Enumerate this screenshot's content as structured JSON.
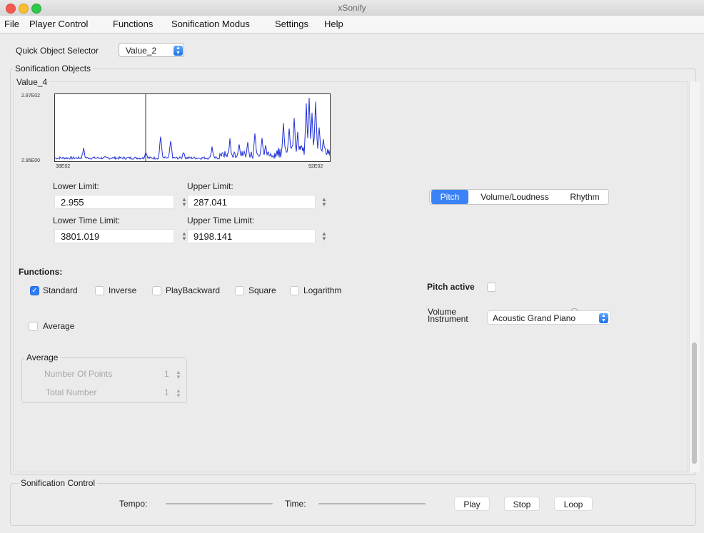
{
  "window": {
    "title": "xSonify"
  },
  "menu": [
    "File",
    "Player Control",
    "Functions",
    "Sonification Modus",
    "Settings",
    "Help"
  ],
  "quick_selector": {
    "label": "Quick Object Selector",
    "value": "Value_2"
  },
  "sonification_objects": {
    "legend": "Sonification Objects",
    "object_title": "Value_4",
    "plot": {
      "y_top_label": "2.87E02",
      "y_bottom_label": "2.95E00",
      "x_left_label": "38E02",
      "x_right_label": "92E02",
      "line_color": "#1f2fd6"
    },
    "limits": {
      "lower_label": "Lower Limit:",
      "lower_value": "2.955",
      "upper_label": "Upper Limit:",
      "upper_value": "287.041",
      "lower_time_label": "Lower Time Limit:",
      "lower_time_value": "3801.019",
      "upper_time_label": "Upper Time Limit:",
      "upper_time_value": "9198.141"
    },
    "functions": {
      "title": "Functions:",
      "options": [
        {
          "label": "Standard",
          "checked": true
        },
        {
          "label": "Inverse",
          "checked": false
        },
        {
          "label": "PlayBackward",
          "checked": false
        },
        {
          "label": "Square",
          "checked": false
        },
        {
          "label": "Logarithm",
          "checked": false
        }
      ]
    },
    "average_check": {
      "label": "Average",
      "checked": false
    },
    "average_group": {
      "legend": "Average",
      "points_label": "Number Of Points",
      "points_value": "1",
      "total_label": "Total Number",
      "total_value": "1"
    },
    "tabs": [
      "Pitch",
      "Volume/Loudness",
      "Rhythm"
    ],
    "selected_tab": "Pitch",
    "pitch": {
      "active_label": "Pitch active",
      "active_checked": false,
      "volume_label": "Volume",
      "volume_level": 0.75,
      "instrument_label": "Instrument",
      "instrument_value": "Acoustic Grand Piano"
    }
  },
  "control": {
    "legend": "Sonification Control",
    "tempo_label": "Tempo:",
    "time_label": "Time:",
    "play": "Play",
    "stop": "Stop",
    "loop": "Loop"
  },
  "colors": {
    "accent": "#3b82f6",
    "plot_line": "#1f2fd6"
  }
}
